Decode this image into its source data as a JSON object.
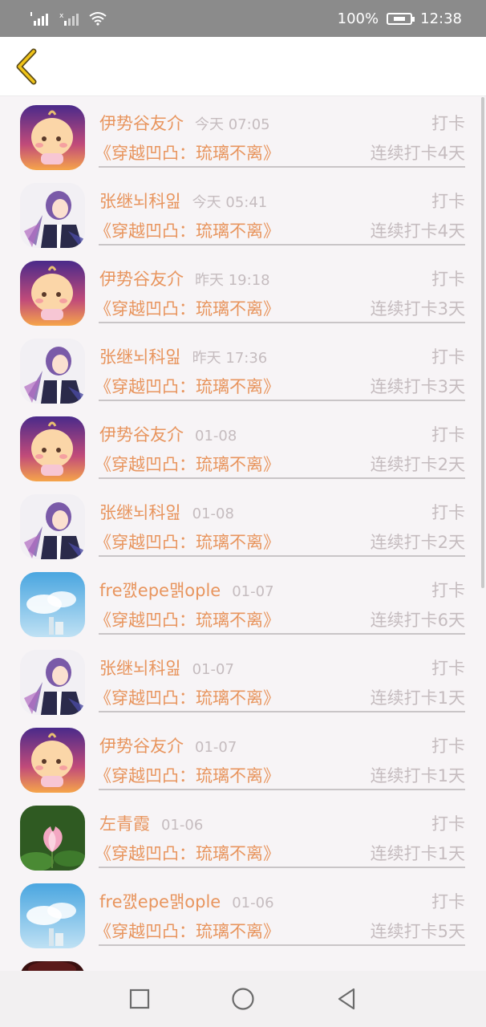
{
  "status_bar": {
    "battery": "100%",
    "time": "12:38"
  },
  "list": [
    {
      "name": "伊势谷友介",
      "time": "今天 07:05",
      "action": "打卡",
      "book": "《穿越凹凸：琉璃不离》",
      "streak": "连续打卡4天",
      "avatar": "baby-avatar"
    },
    {
      "name": "张继뇌科잂",
      "time": "今天 05:41",
      "action": "打卡",
      "book": "《穿越凹凸：琉璃不离》",
      "streak": "连续打卡4天",
      "avatar": "anime-avatar"
    },
    {
      "name": "伊势谷友介",
      "time": "昨天 19:18",
      "action": "打卡",
      "book": "《穿越凹凸：琉璃不离》",
      "streak": "连续打卡3天",
      "avatar": "baby-avatar"
    },
    {
      "name": "张继뇌科잂",
      "time": "昨天 17:36",
      "action": "打卡",
      "book": "《穿越凹凸：琉璃不离》",
      "streak": "连续打卡3天",
      "avatar": "anime-avatar"
    },
    {
      "name": "伊势谷友介",
      "time": "01-08",
      "action": "打卡",
      "book": "《穿越凹凸：琉璃不离》",
      "streak": "连续打卡2天",
      "avatar": "baby-avatar"
    },
    {
      "name": "张继뇌科잂",
      "time": "01-08",
      "action": "打卡",
      "book": "《穿越凹凸：琉璃不离》",
      "streak": "连续打卡2天",
      "avatar": "anime-avatar"
    },
    {
      "name": "fre꺬epe맭ople",
      "time": "01-07",
      "action": "打卡",
      "book": "《穿越凹凸：琉璃不离》",
      "streak": "连续打卡6天",
      "avatar": "sky-avatar"
    },
    {
      "name": "张继뇌科잂",
      "time": "01-07",
      "action": "打卡",
      "book": "《穿越凹凸：琉璃不离》",
      "streak": "连续打卡1天",
      "avatar": "anime-avatar"
    },
    {
      "name": "伊势谷友介",
      "time": "01-07",
      "action": "打卡",
      "book": "《穿越凹凸：琉璃不离》",
      "streak": "连续打卡1天",
      "avatar": "baby-avatar"
    },
    {
      "name": "左青霞",
      "time": "01-06",
      "action": "打卡",
      "book": "《穿越凹凸：琉璃不离》",
      "streak": "连续打卡1天",
      "avatar": "lotus-avatar"
    },
    {
      "name": "fre꺬epe맭ople",
      "time": "01-06",
      "action": "打卡",
      "book": "《穿越凹凸：琉璃不离》",
      "streak": "连续打卡5天",
      "avatar": "sky-avatar"
    },
    {
      "name": "",
      "time": "",
      "action": "",
      "book": "",
      "streak": "",
      "avatar": "dark-avatar"
    }
  ],
  "colors": {
    "accent": "#e8955e",
    "muted": "#c5bcbf",
    "back_icon": "#f0c419"
  }
}
